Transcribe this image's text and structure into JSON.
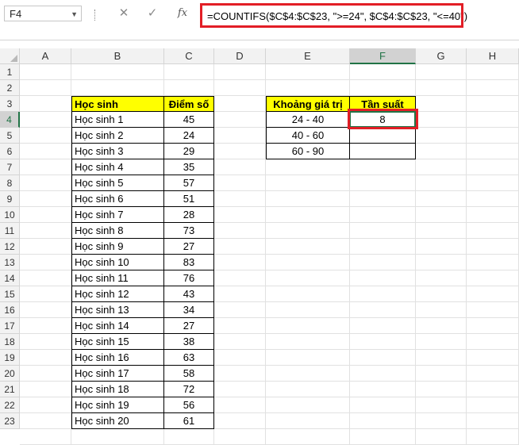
{
  "name_box": {
    "value": "F4"
  },
  "formula_bar": {
    "cancel_icon": "✕",
    "enter_icon": "✓",
    "fx_label": "fx",
    "formula": "=COUNTIFS($C$4:$C$23, \">=24\", $C$4:$C$23, \"<=40\")"
  },
  "columns": [
    "A",
    "B",
    "C",
    "D",
    "E",
    "F",
    "G",
    "H"
  ],
  "rows": [
    "1",
    "2",
    "3",
    "4",
    "5",
    "6",
    "7",
    "8",
    "9",
    "10",
    "11",
    "12",
    "13",
    "14",
    "15",
    "16",
    "17",
    "18",
    "19",
    "20",
    "21",
    "22",
    "23"
  ],
  "student_table": {
    "header_name": "Học sinh",
    "header_score": "Điểm số",
    "rows": [
      {
        "name": "Học sinh 1",
        "score": "45"
      },
      {
        "name": "Học sinh 2",
        "score": "24"
      },
      {
        "name": "Học sinh 3",
        "score": "29"
      },
      {
        "name": "Học sinh 4",
        "score": "35"
      },
      {
        "name": "Học sinh 5",
        "score": "57"
      },
      {
        "name": "Học sinh 6",
        "score": "51"
      },
      {
        "name": "Học sinh 7",
        "score": "28"
      },
      {
        "name": "Học sinh 8",
        "score": "73"
      },
      {
        "name": "Học sinh 9",
        "score": "27"
      },
      {
        "name": "Học sinh 10",
        "score": "83"
      },
      {
        "name": "Học sinh 11",
        "score": "76"
      },
      {
        "name": "Học sinh 12",
        "score": "43"
      },
      {
        "name": "Học sinh 13",
        "score": "34"
      },
      {
        "name": "Học sinh 14",
        "score": "27"
      },
      {
        "name": "Học sinh 15",
        "score": "38"
      },
      {
        "name": "Học sinh 16",
        "score": "63"
      },
      {
        "name": "Học sinh 17",
        "score": "58"
      },
      {
        "name": "Học sinh 18",
        "score": "72"
      },
      {
        "name": "Học sinh 19",
        "score": "56"
      },
      {
        "name": "Học sinh 20",
        "score": "61"
      }
    ]
  },
  "frequency_table": {
    "header_range": "Khoảng giá trị",
    "header_freq": "Tần suất",
    "rows": [
      {
        "range": "24 - 40",
        "freq": "8"
      },
      {
        "range": "40 - 60",
        "freq": ""
      },
      {
        "range": "60 - 90",
        "freq": ""
      }
    ]
  },
  "colors": {
    "highlight": "#ffff00",
    "annotation": "#e21e26",
    "selection": "#217346"
  }
}
